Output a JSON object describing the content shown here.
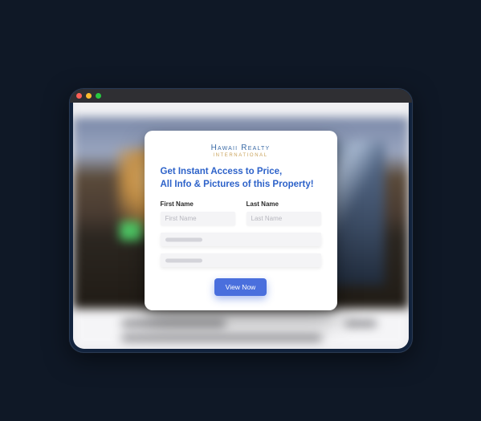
{
  "logo": {
    "main": "Hawaii Realty",
    "sub": "International"
  },
  "headline": {
    "line1": "Get Instant Access to Price,",
    "line2": "All Info & Pictures of this Property!"
  },
  "form": {
    "first_name": {
      "label": "First Name",
      "placeholder": "First Name"
    },
    "last_name": {
      "label": "Last Name",
      "placeholder": "Last Name"
    },
    "submit_label": "View Now"
  },
  "colors": {
    "accent": "#4a6fdd",
    "headline": "#2d62c9",
    "logo_main": "#3a6aa6",
    "logo_sub": "#c9a25a"
  }
}
